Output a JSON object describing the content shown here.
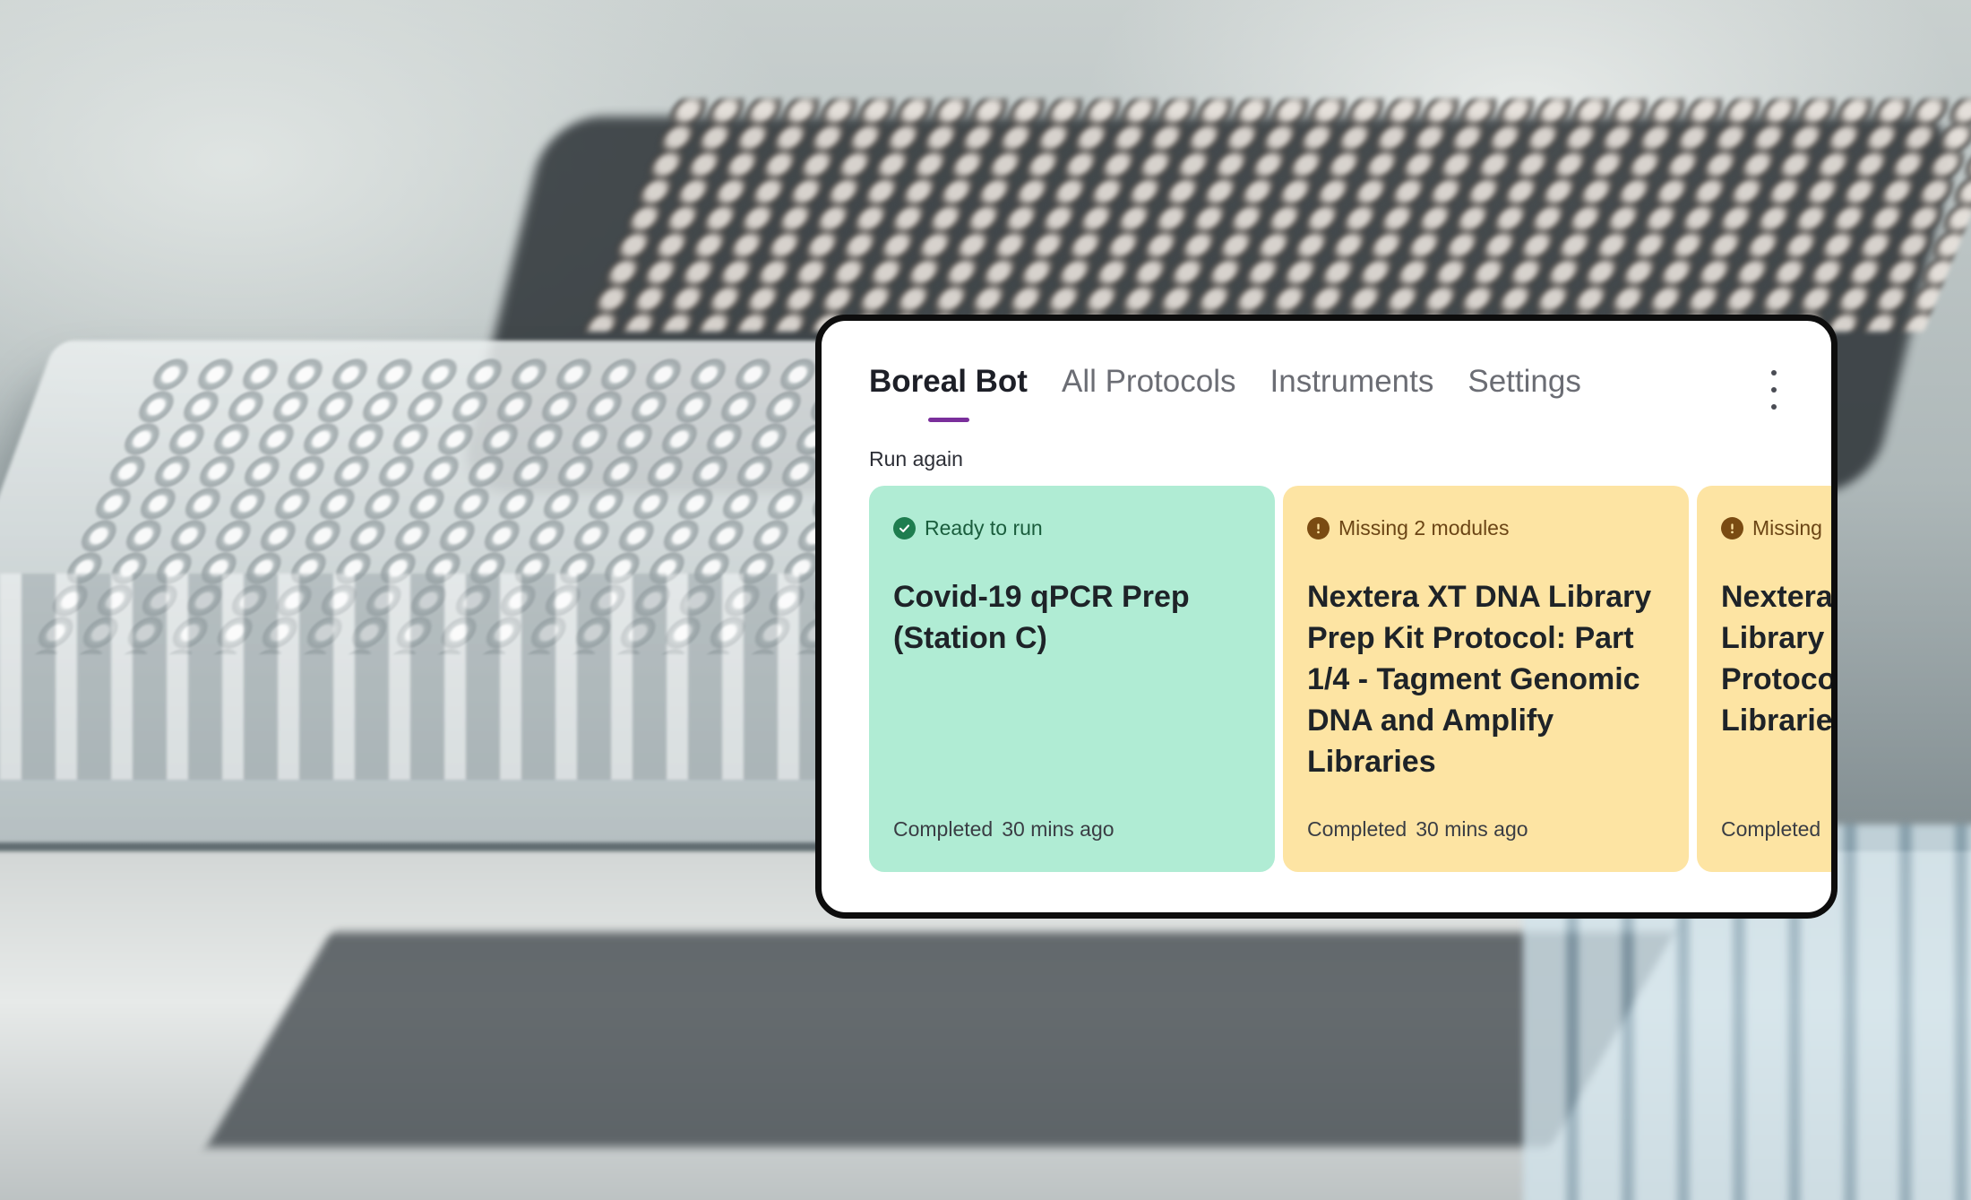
{
  "app": {
    "tabs": [
      {
        "label": "Boreal Bot",
        "active": true
      },
      {
        "label": "All Protocols",
        "active": false
      },
      {
        "label": "Instruments",
        "active": false
      },
      {
        "label": "Settings",
        "active": false
      }
    ],
    "menu_icon": "more-vertical-icon",
    "accent_color": "#7a2f9b"
  },
  "run_again": {
    "section_label": "Run again",
    "cards": [
      {
        "status": "Ready to run",
        "status_icon": "check-circle-icon",
        "status_color": "#1e7d4f",
        "background": "#b0ecd4",
        "title": "Covid-19 qPCR Prep (Station C)",
        "completed_label": "Completed",
        "completed_time": "30 mins ago"
      },
      {
        "status": "Missing 2 modules",
        "status_icon": "alert-circle-icon",
        "status_color": "#7a4b12",
        "background": "#fde4a3",
        "title": "Nextera XT DNA Library Prep Kit Protocol: Part 1/4 - Tagment Genomic DNA and Amplify Libraries",
        "completed_label": "Completed",
        "completed_time": "30 mins ago"
      },
      {
        "status": "Missing",
        "status_icon": "alert-circle-icon",
        "status_color": "#7a4b12",
        "background": "#fde4a3",
        "title": "Nextera Library Protoco Librarie",
        "completed_label": "Completed",
        "completed_time": ""
      }
    ]
  }
}
